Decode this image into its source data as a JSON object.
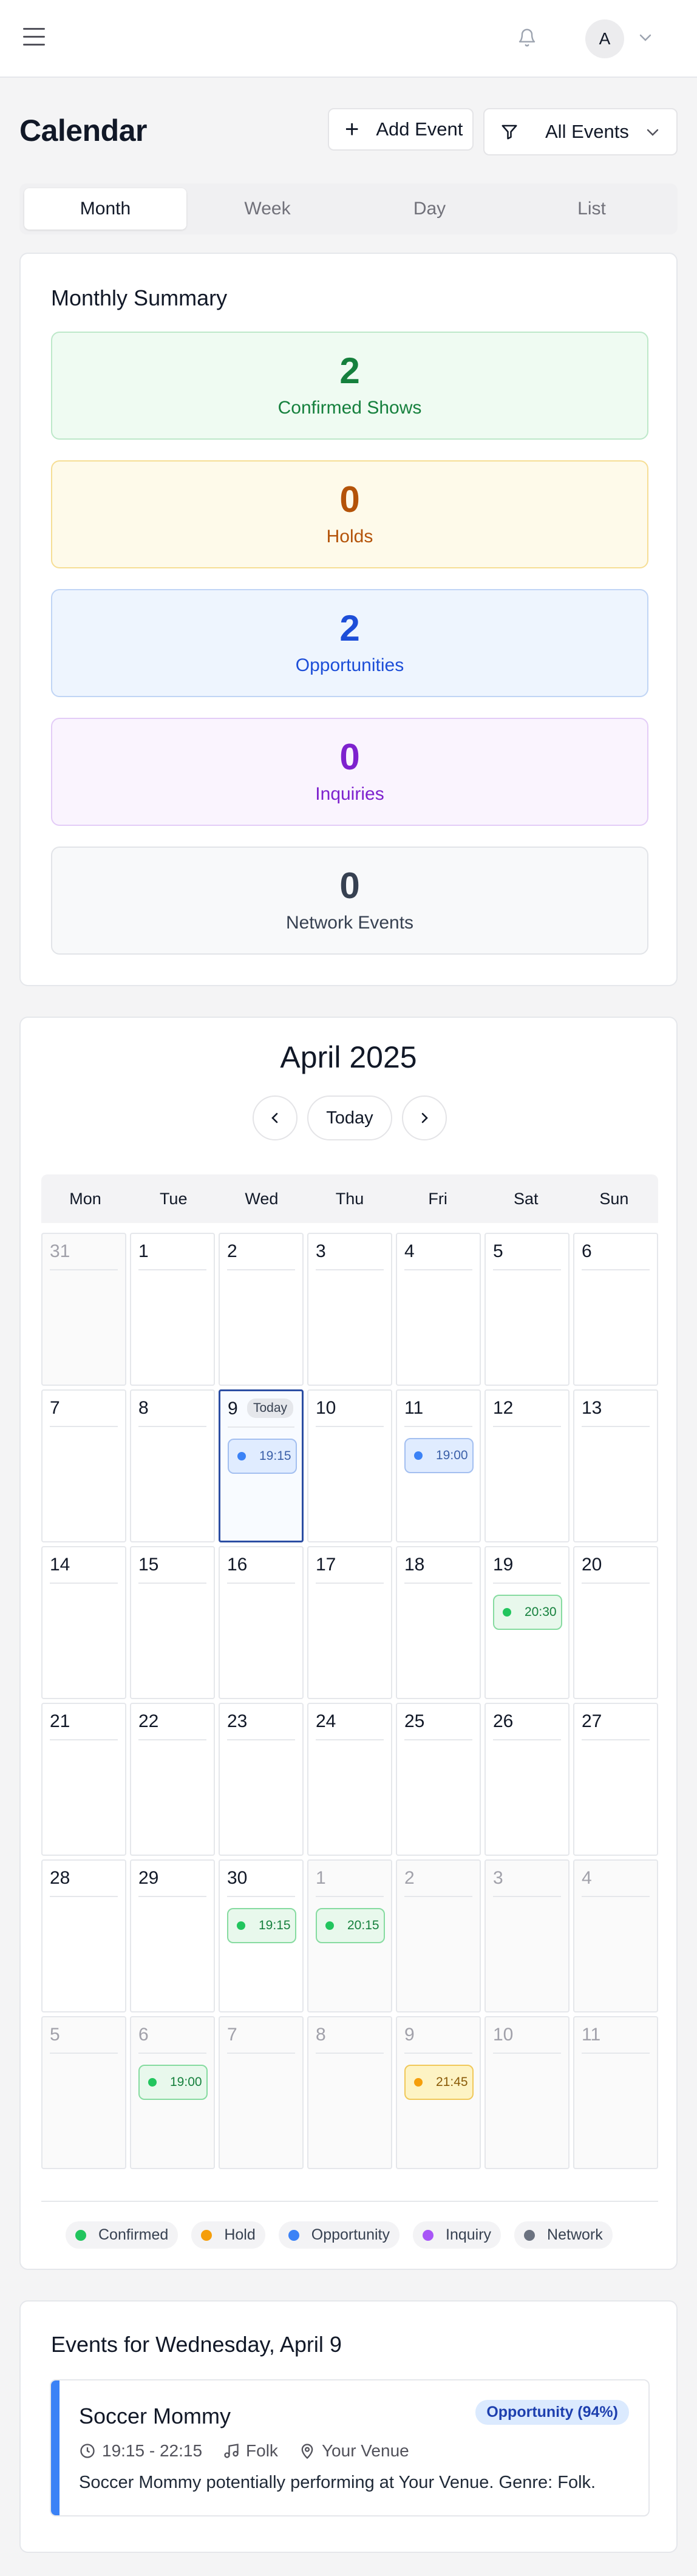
{
  "header": {
    "avatar_initial": "A",
    "icons": [
      "menu-icon",
      "bell-icon",
      "chevron-down-icon"
    ]
  },
  "page": {
    "title": "Calendar",
    "add_event_label": "Add Event",
    "filter_label": "All Events"
  },
  "tabs": [
    {
      "label": "Month",
      "active": true
    },
    {
      "label": "Week",
      "active": false
    },
    {
      "label": "Day",
      "active": false
    },
    {
      "label": "List",
      "active": false
    }
  ],
  "summary": {
    "title": "Monthly Summary",
    "stats": [
      {
        "value": "2",
        "label": "Confirmed Shows",
        "bg": "#effbf2",
        "border": "#bde8c9",
        "color": "#15803d"
      },
      {
        "value": "0",
        "label": "Holds",
        "bg": "#fefaea",
        "border": "#f6de95",
        "color": "#b45309"
      },
      {
        "value": "2",
        "label": "Opportunities",
        "bg": "#eef5fe",
        "border": "#c0d5f5",
        "color": "#1d4ed8"
      },
      {
        "value": "0",
        "label": "Inquiries",
        "bg": "#faf4fe",
        "border": "#e3ccf7",
        "color": "#7e22ce"
      },
      {
        "value": "0",
        "label": "Network Events",
        "bg": "#f8f9fa",
        "border": "#e2e4e8",
        "color": "#374151"
      }
    ]
  },
  "calendar": {
    "month_title": "April 2025",
    "today_label": "Today",
    "weekdays": [
      "Mon",
      "Tue",
      "Wed",
      "Thu",
      "Fri",
      "Sat",
      "Sun"
    ],
    "weeks": [
      [
        {
          "d": "31",
          "other": true
        },
        {
          "d": "1"
        },
        {
          "d": "2"
        },
        {
          "d": "3"
        },
        {
          "d": "4"
        },
        {
          "d": "5"
        },
        {
          "d": "6"
        }
      ],
      [
        {
          "d": "7"
        },
        {
          "d": "8"
        },
        {
          "d": "9",
          "today": true,
          "events": [
            {
              "time": "19:15",
              "type": "opportunity"
            }
          ]
        },
        {
          "d": "10"
        },
        {
          "d": "11",
          "events": [
            {
              "time": "19:00",
              "type": "opportunity"
            }
          ]
        },
        {
          "d": "12"
        },
        {
          "d": "13"
        }
      ],
      [
        {
          "d": "14"
        },
        {
          "d": "15"
        },
        {
          "d": "16"
        },
        {
          "d": "17"
        },
        {
          "d": "18"
        },
        {
          "d": "19",
          "events": [
            {
              "time": "20:30",
              "type": "confirmed"
            }
          ]
        },
        {
          "d": "20"
        }
      ],
      [
        {
          "d": "21"
        },
        {
          "d": "22"
        },
        {
          "d": "23"
        },
        {
          "d": "24"
        },
        {
          "d": "25"
        },
        {
          "d": "26"
        },
        {
          "d": "27"
        }
      ],
      [
        {
          "d": "28"
        },
        {
          "d": "29"
        },
        {
          "d": "30",
          "events": [
            {
              "time": "19:15",
              "type": "confirmed"
            }
          ]
        },
        {
          "d": "1",
          "other": true,
          "events": [
            {
              "time": "20:15",
              "type": "confirmed"
            }
          ]
        },
        {
          "d": "2",
          "other": true
        },
        {
          "d": "3",
          "other": true
        },
        {
          "d": "4",
          "other": true
        }
      ],
      [
        {
          "d": "5",
          "other": true
        },
        {
          "d": "6",
          "other": true,
          "events": [
            {
              "time": "19:00",
              "type": "confirmed"
            }
          ]
        },
        {
          "d": "7",
          "other": true
        },
        {
          "d": "8",
          "other": true
        },
        {
          "d": "9",
          "other": true,
          "events": [
            {
              "time": "21:45",
              "type": "hold"
            }
          ]
        },
        {
          "d": "10",
          "other": true
        },
        {
          "d": "11",
          "other": true
        }
      ]
    ]
  },
  "legend": [
    {
      "label": "Confirmed",
      "color": "#22c55e"
    },
    {
      "label": "Hold",
      "color": "#f59e0b"
    },
    {
      "label": "Opportunity",
      "color": "#3b82f6"
    },
    {
      "label": "Inquiry",
      "color": "#a855f7"
    },
    {
      "label": "Network",
      "color": "#6b7280"
    }
  ],
  "events_section": {
    "title": "Events for Wednesday, April 9",
    "event": {
      "name": "Soccer Mommy",
      "badge": "Opportunity (94%)",
      "time": "19:15 - 22:15",
      "genre": "Folk",
      "venue": "Your Venue",
      "description": "Soccer Mommy potentially performing at Your Venue. Genre: Folk."
    }
  }
}
